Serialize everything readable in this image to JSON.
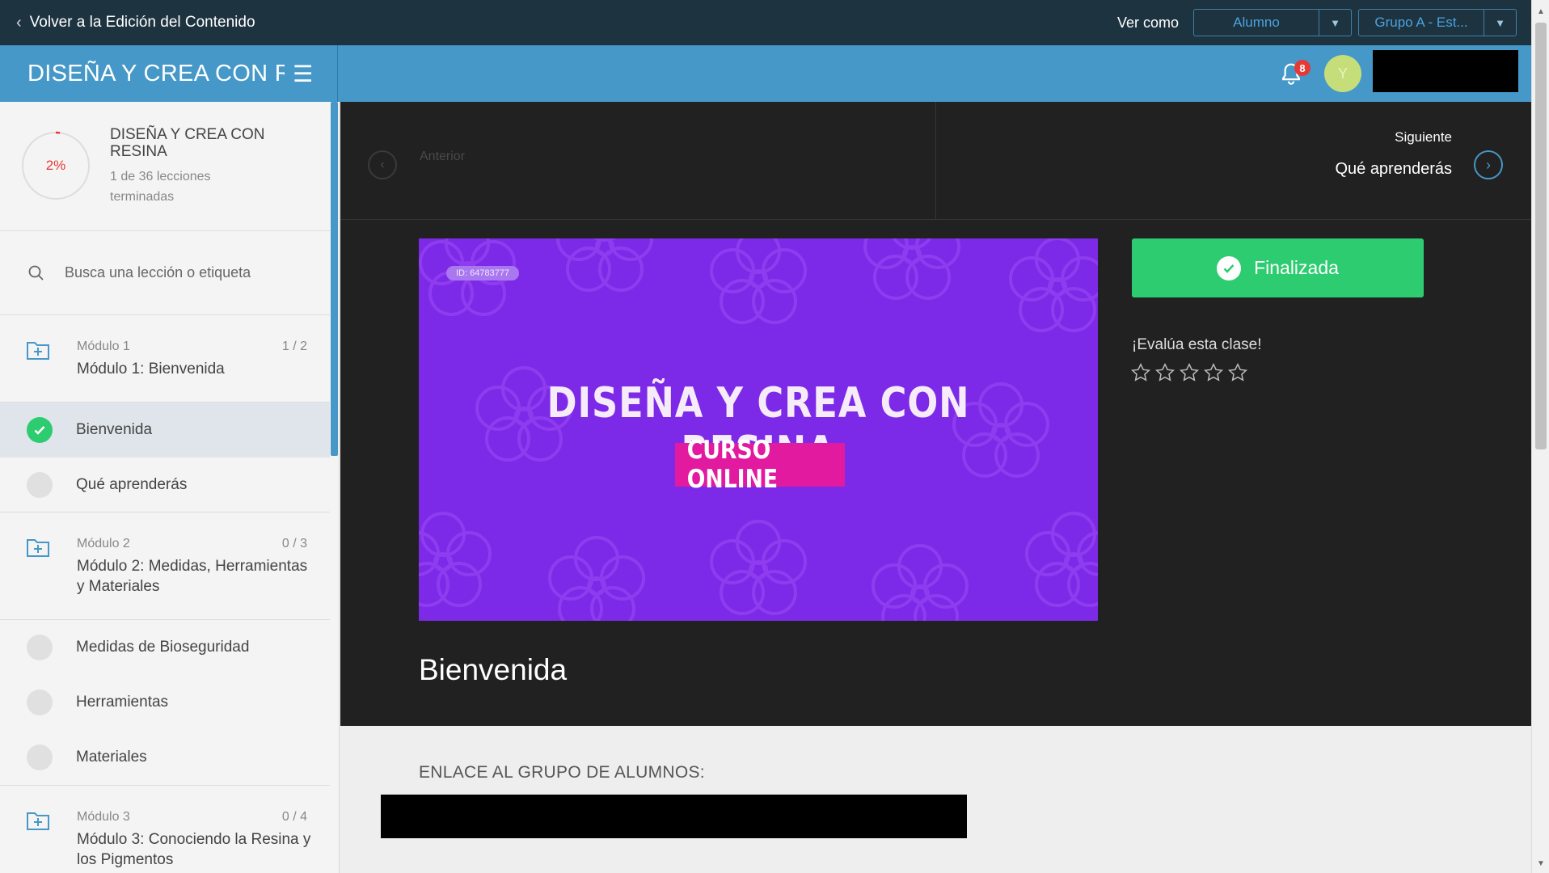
{
  "topbar": {
    "back_label": "Volver a la Edición del Contenido",
    "ver_como_label": "Ver como",
    "role_dropdown": "Alumno",
    "group_dropdown": "Grupo A - Est..."
  },
  "header": {
    "course_title": "DISEÑA Y CREA CON RESINA",
    "notification_count": "8",
    "avatar_initial": "Y"
  },
  "sidebar": {
    "progress": {
      "percent": 2,
      "percent_label": "2%",
      "course_title": "DISEÑA Y CREA CON RESINA",
      "lessons_done": "1 de 36 lecciones terminadas"
    },
    "search_placeholder": "Busca una lección o etiqueta",
    "modules": [
      {
        "number": "Módulo 1",
        "title": "Módulo 1: Bienvenida",
        "count": "1 / 2",
        "lessons": [
          {
            "label": "Bienvenida",
            "done": true
          },
          {
            "label": "Qué aprenderás",
            "done": false
          }
        ]
      },
      {
        "number": "Módulo 2",
        "title": "Módulo 2: Medidas, Herramientas y Materiales",
        "count": "0 / 3",
        "lessons": [
          {
            "label": "Medidas de Bioseguridad",
            "done": false
          },
          {
            "label": "Herramientas",
            "done": false
          },
          {
            "label": "Materiales",
            "done": false
          }
        ]
      },
      {
        "number": "Módulo 3",
        "title": "Módulo 3: Conociendo la Resina y los Pigmentos",
        "count": "0 / 4",
        "lessons": []
      }
    ]
  },
  "nav": {
    "prev_label": "Anterior",
    "next_label": "Siguiente",
    "next_title": "Qué aprenderás"
  },
  "video": {
    "id_badge": "ID: 64783777",
    "title": "DISEÑA Y CREA CON RESINA",
    "subtitle": "CURSO ONLINE"
  },
  "lesson": {
    "title": "Bienvenida",
    "finish_label": "Finalizada",
    "rate_label": "¡Evalúa esta clase!",
    "rating": 0,
    "rating_max": 5
  },
  "content": {
    "link_label": "ENLACE AL GRUPO DE ALUMNOS:"
  },
  "colors": {
    "topbar": "#1e3340",
    "header": "#4598c8",
    "success": "#2ecc71",
    "video_bg": "#7d2ae8",
    "video_pink": "#e11aa0"
  }
}
